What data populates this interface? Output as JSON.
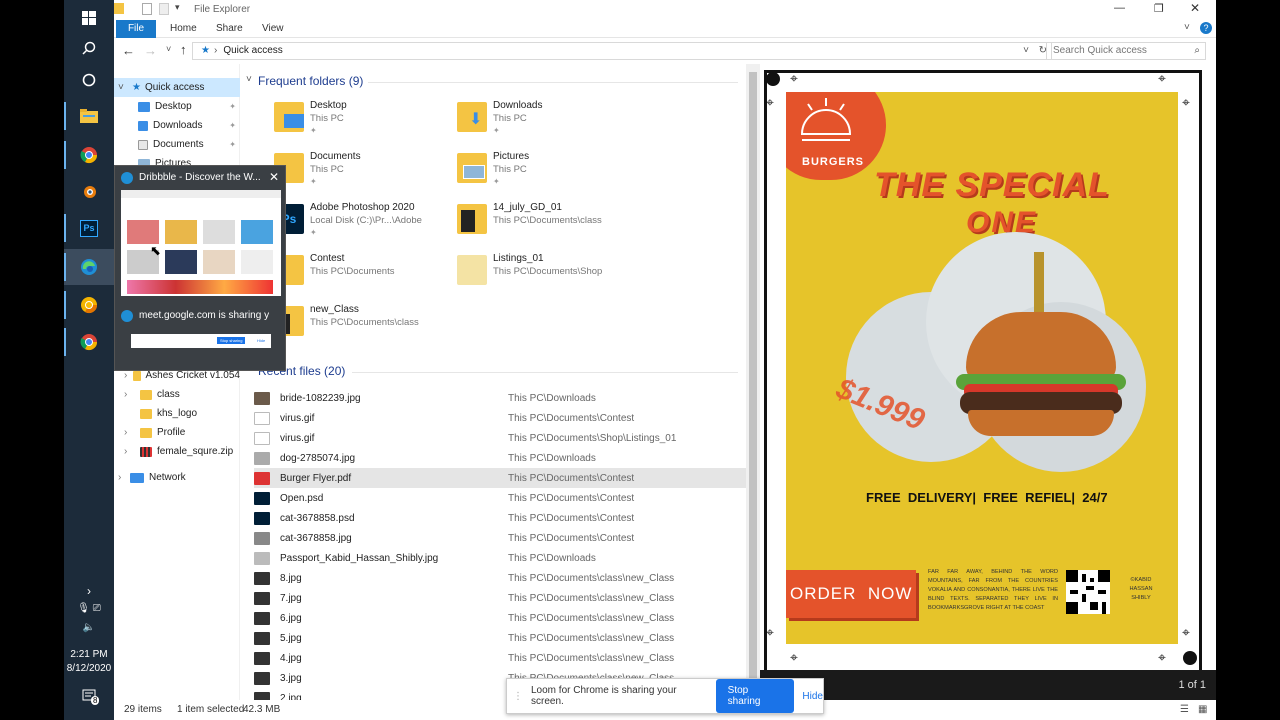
{
  "taskbar": {
    "time": "2:21 PM",
    "date": "8/12/2020",
    "notif_count": "8",
    "icons": [
      "windows-icon",
      "search-icon",
      "cortana-icon",
      "file-explorer-icon",
      "chrome-icon",
      "blender-icon",
      "photoshop-icon",
      "edge-icon",
      "chrome-canary-icon",
      "chrome-icon"
    ]
  },
  "window": {
    "title": "File Explorer",
    "ribbon_tabs": {
      "file": "File",
      "home": "Home",
      "share": "Share",
      "view": "View"
    },
    "address": "Quick access",
    "search_placeholder": "Search Quick access"
  },
  "nav": {
    "quick_access": "Quick access",
    "items": [
      "Desktop",
      "Downloads",
      "Documents",
      "Pictures"
    ],
    "lower_items": [
      "Ashes Cricket v1.054",
      "class",
      "khs_logo",
      "Profile",
      "female_squre.zip"
    ],
    "network": "Network"
  },
  "frequent": {
    "heading": "Frequent folders (9)",
    "folders": [
      {
        "name": "Desktop",
        "path": "This PC"
      },
      {
        "name": "Downloads",
        "path": "This PC"
      },
      {
        "name": "Documents",
        "path": "This PC"
      },
      {
        "name": "Pictures",
        "path": "This PC"
      },
      {
        "name": "Adobe Photoshop 2020",
        "path": "Local Disk (C:)\\Pr...\\Adobe"
      },
      {
        "name": "14_july_GD_01",
        "path": "This PC\\Documents\\class"
      },
      {
        "name": "Contest",
        "path": "This PC\\Documents"
      },
      {
        "name": "Listings_01",
        "path": "This PC\\Documents\\Shop"
      },
      {
        "name": "new_Class",
        "path": "This PC\\Documents\\class"
      }
    ]
  },
  "recent": {
    "heading": "Recent files (20)",
    "files": [
      {
        "name": "bride-1082239.jpg",
        "path": "This PC\\Downloads"
      },
      {
        "name": "virus.gif",
        "path": "This PC\\Documents\\Contest"
      },
      {
        "name": "virus.gif",
        "path": "This PC\\Documents\\Shop\\Listings_01"
      },
      {
        "name": "dog-2785074.jpg",
        "path": "This PC\\Downloads"
      },
      {
        "name": "Burger Flyer.pdf",
        "path": "This PC\\Documents\\Contest"
      },
      {
        "name": "Open.psd",
        "path": "This PC\\Documents\\Contest"
      },
      {
        "name": "cat-3678858.psd",
        "path": "This PC\\Documents\\Contest"
      },
      {
        "name": "cat-3678858.jpg",
        "path": "This PC\\Documents\\Contest"
      },
      {
        "name": "Passport_Kabid_Hassan_Shibly.jpg",
        "path": "This PC\\Downloads"
      },
      {
        "name": "8.jpg",
        "path": "This PC\\Documents\\class\\new_Class"
      },
      {
        "name": "7.jpg",
        "path": "This PC\\Documents\\class\\new_Class"
      },
      {
        "name": "6.jpg",
        "path": "This PC\\Documents\\class\\new_Class"
      },
      {
        "name": "5.jpg",
        "path": "This PC\\Documents\\class\\new_Class"
      },
      {
        "name": "4.jpg",
        "path": "This PC\\Documents\\class\\new_Class"
      },
      {
        "name": "3.jpg",
        "path": "This PC\\Documents\\class\\new_Class"
      },
      {
        "name": "2.jpg",
        "path": ""
      }
    ]
  },
  "status": {
    "items": "29 items",
    "selected": "1 item selected",
    "size": "42.3 MB"
  },
  "preview": {
    "brand": "BURGERS",
    "headline1": "THE SPECIAL",
    "headline2": "ONE",
    "price": "$1.999",
    "tagline": "FREE  DELIVERY|  FREE  REFIEL|  24/7",
    "order": "ORDER  NOW",
    "body_text": "FAR FAR AWAY, BEHIND THE WORD MOUNTAINS, FAR FROM THE COUNTRIES VOKALIA AND CONSONANTIA, THERE LIVE THE BLIND TEXTS. SEPARATED THEY LIVE IN BOOKMARKSGROVE RIGHT AT THE COAST",
    "credit": "©KABID HASSAN SHIBLY",
    "page": "1 of 1"
  },
  "popup": {
    "tab1": "Dribbble - Discover the W...",
    "tab2": "meet.google.com is sharing yo...",
    "stop": "Stop sharing",
    "hide": "Hide"
  },
  "loom": {
    "text": "Loom for Chrome is sharing your screen.",
    "stop": "Stop sharing",
    "hide": "Hide"
  }
}
